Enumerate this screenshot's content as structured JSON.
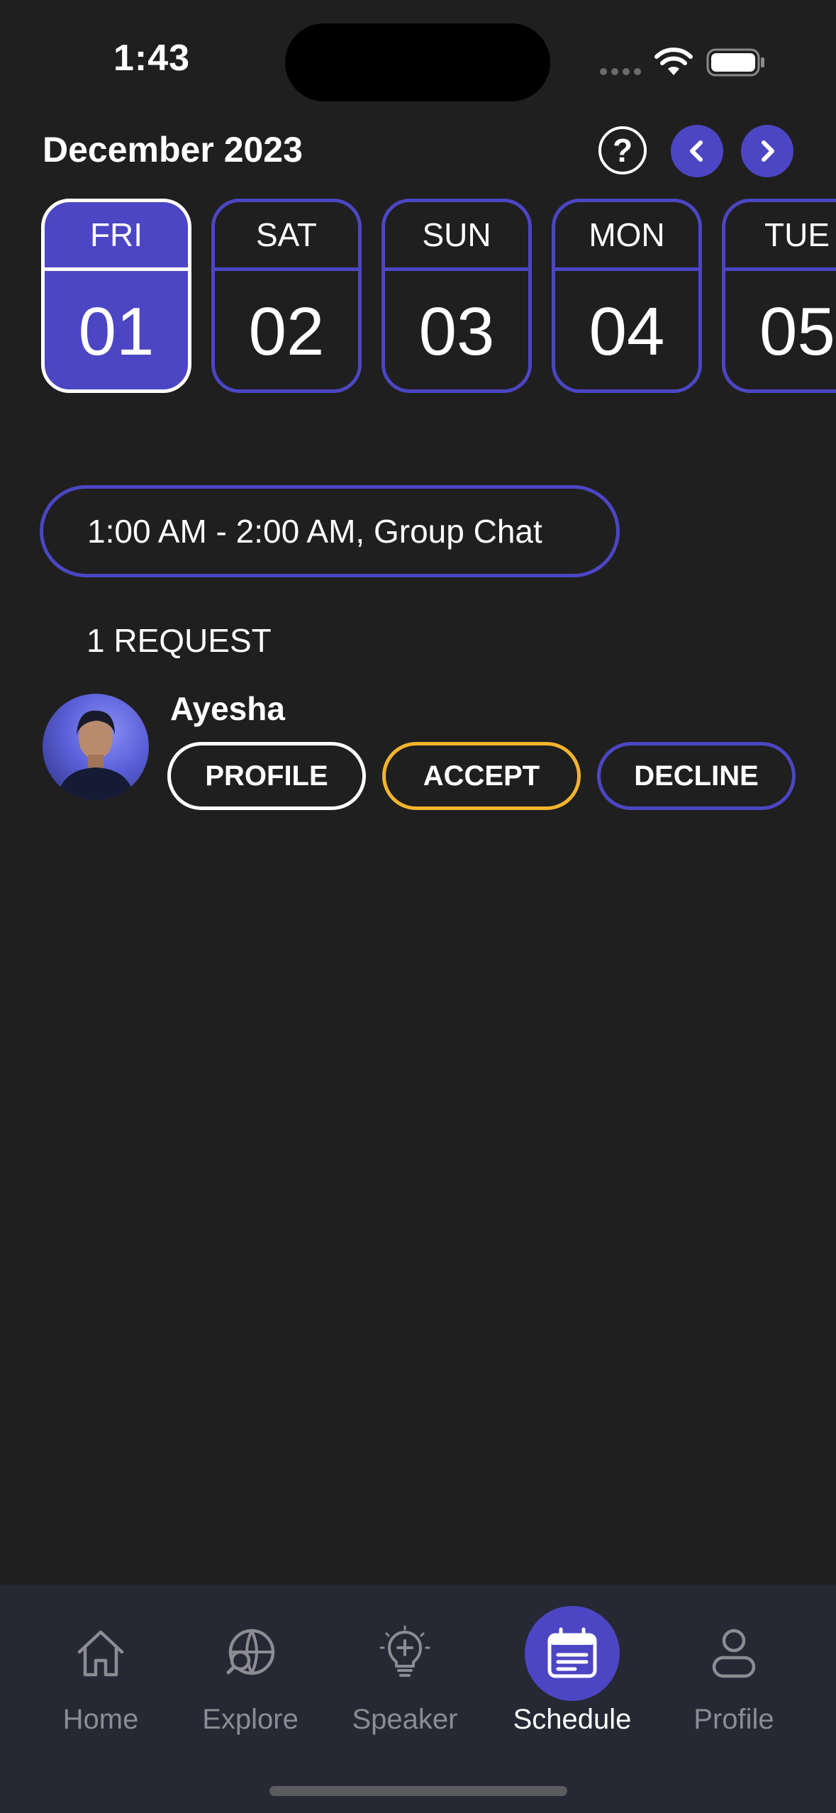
{
  "status_bar": {
    "time": "1:43"
  },
  "header": {
    "month_title": "December 2023",
    "help_symbol": "?"
  },
  "days": [
    {
      "name": "FRI",
      "number": "01",
      "selected": true
    },
    {
      "name": "SAT",
      "number": "02",
      "selected": false
    },
    {
      "name": "SUN",
      "number": "03",
      "selected": false
    },
    {
      "name": "MON",
      "number": "04",
      "selected": false
    },
    {
      "name": "TUE",
      "number": "05",
      "selected": false
    }
  ],
  "event": {
    "label": "1:00 AM - 2:00 AM, Group Chat"
  },
  "requests": {
    "count_label": "1 REQUEST",
    "items": [
      {
        "name": "Ayesha",
        "profile_label": "PROFILE",
        "accept_label": "ACCEPT",
        "decline_label": "DECLINE"
      }
    ]
  },
  "tabs": [
    {
      "label": "Home",
      "icon": "home-icon",
      "active": false
    },
    {
      "label": "Explore",
      "icon": "globe-search-icon",
      "active": false
    },
    {
      "label": "Speaker",
      "icon": "lightbulb-icon",
      "active": false
    },
    {
      "label": "Schedule",
      "icon": "calendar-icon",
      "active": true
    },
    {
      "label": "Profile",
      "icon": "person-icon",
      "active": false
    }
  ],
  "colors": {
    "background": "#1f1f1f",
    "accent": "#4c46c4",
    "accept_border": "#f2b52c",
    "tab_bar": "#262833",
    "inactive_tab": "#8c8c92"
  }
}
